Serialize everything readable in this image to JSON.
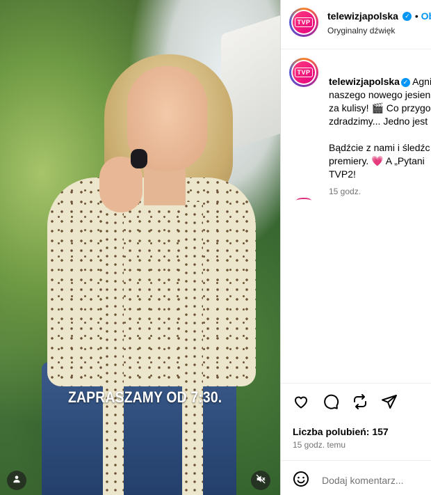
{
  "post": {
    "username": "telewizjapolska",
    "avatar_text": "TVP",
    "follow_label": "Ob",
    "audio": "Oryginalny dźwięk",
    "caption_lines": [
      "Agni",
      "naszego nowego jesien",
      "za kulisy! 🎬 Co przygo",
      "zdradzimy... Jedno jest",
      "",
      "Bądźcie z nami i śledźc",
      "premiery. 💗 A „Pytani",
      "TVP2!"
    ],
    "caption_time": "15 godz.",
    "video_caption": "ZAPRASZAMY OD 7:30.",
    "likes_label": "Liczba polubień: 157",
    "time_ago": "15 godz. temu",
    "comment_placeholder": "Dodaj komentarz..."
  },
  "icons": [
    "heart-icon",
    "comment-icon",
    "share-icon",
    "send-icon",
    "emoji-icon",
    "user-tag-icon",
    "mute-icon",
    "verified-icon"
  ],
  "colors": {
    "accent": "#0095f6",
    "brand": "#e6007e"
  }
}
